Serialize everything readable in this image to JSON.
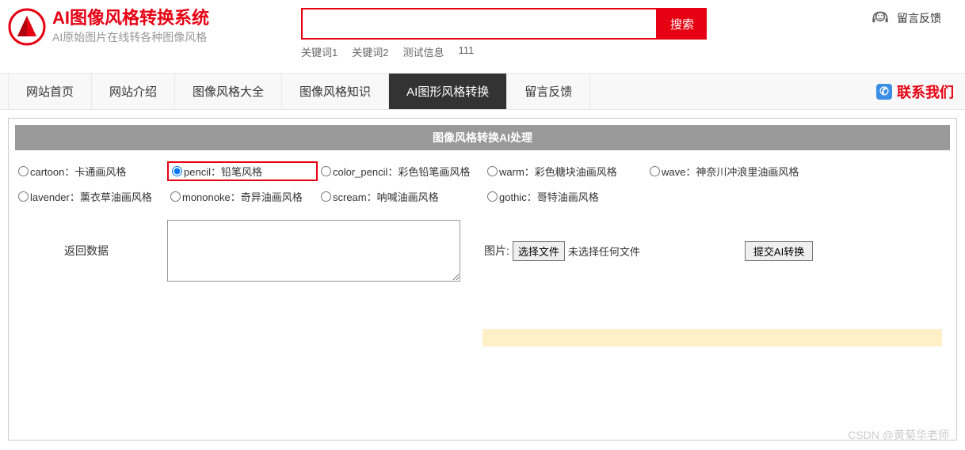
{
  "header": {
    "title": "AI图像风格转换系统",
    "subtitle": "AI原始图片在线转各种图像风格",
    "search_button": "搜索",
    "search_placeholder": "",
    "keywords": [
      "关键词1",
      "关键词2",
      "测试信息",
      "111"
    ],
    "feedback": "留言反馈"
  },
  "nav": {
    "items": [
      {
        "label": "网站首页"
      },
      {
        "label": "网站介绍"
      },
      {
        "label": "图像风格大全"
      },
      {
        "label": "图像风格知识"
      },
      {
        "label": "AI图形风格转换",
        "active": true
      },
      {
        "label": "留言反馈"
      }
    ],
    "contact": "联系我们"
  },
  "panel": {
    "title": "图像风格转换AI处理",
    "styles_row1": [
      {
        "label": "cartoon：卡通画风格"
      },
      {
        "label": "pencil：铅笔风格",
        "checked": true,
        "highlight": true
      },
      {
        "label": "color_pencil：彩色铅笔画风格"
      },
      {
        "label": "warm：彩色糖块油画风格"
      },
      {
        "label": "wave：神奈川冲浪里油画风格"
      }
    ],
    "styles_row2": [
      {
        "label": "lavender：薰衣草油画风格"
      },
      {
        "label": "mononoke：奇异油画风格"
      },
      {
        "label": "scream：呐喊油画风格"
      },
      {
        "label": "gothic：哥特油画风格"
      }
    ],
    "return_label": "返回数据",
    "img_label": "图片:",
    "choose_file": "选择文件",
    "no_file": "未选择任何文件",
    "submit": "提交AI转换"
  },
  "watermark": "CSDN @黄菊华老师"
}
